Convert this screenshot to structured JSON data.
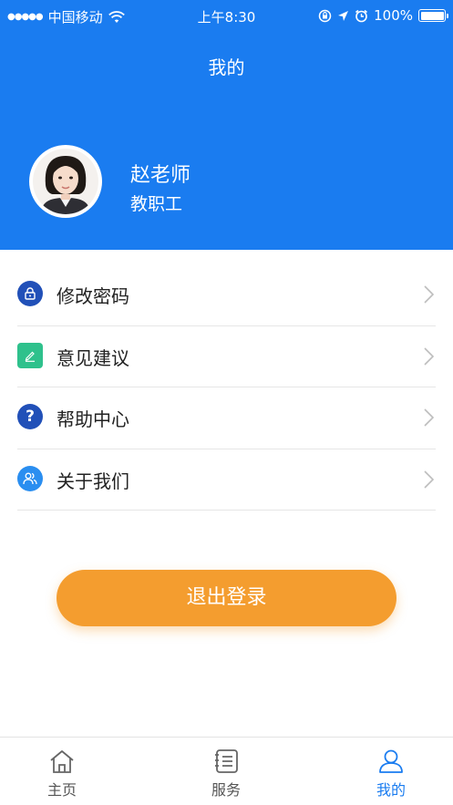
{
  "status_bar": {
    "carrier": "中国移动",
    "time": "上午8:30",
    "battery": "100%"
  },
  "header": {
    "title": "我的"
  },
  "profile": {
    "name": "赵老师",
    "role": "教职工"
  },
  "menu": [
    {
      "label": "修改密码",
      "icon": "lock-icon",
      "color": "#2150b8"
    },
    {
      "label": "意见建议",
      "icon": "edit-icon",
      "color": "#2ec18c"
    },
    {
      "label": "帮助中心",
      "icon": "help-icon",
      "color": "#2150b8"
    },
    {
      "label": "关于我们",
      "icon": "people-icon",
      "color": "#2a8ef0"
    }
  ],
  "logout_label": "退出登录",
  "tabs": [
    {
      "label": "主页",
      "icon": "home-icon",
      "active": false
    },
    {
      "label": "服务",
      "icon": "service-icon",
      "active": false
    },
    {
      "label": "我的",
      "icon": "profile-icon",
      "active": true
    }
  ],
  "colors": {
    "primary": "#1a7cf0",
    "logout": "#f49d2f",
    "divider": "#e6e6e6"
  }
}
